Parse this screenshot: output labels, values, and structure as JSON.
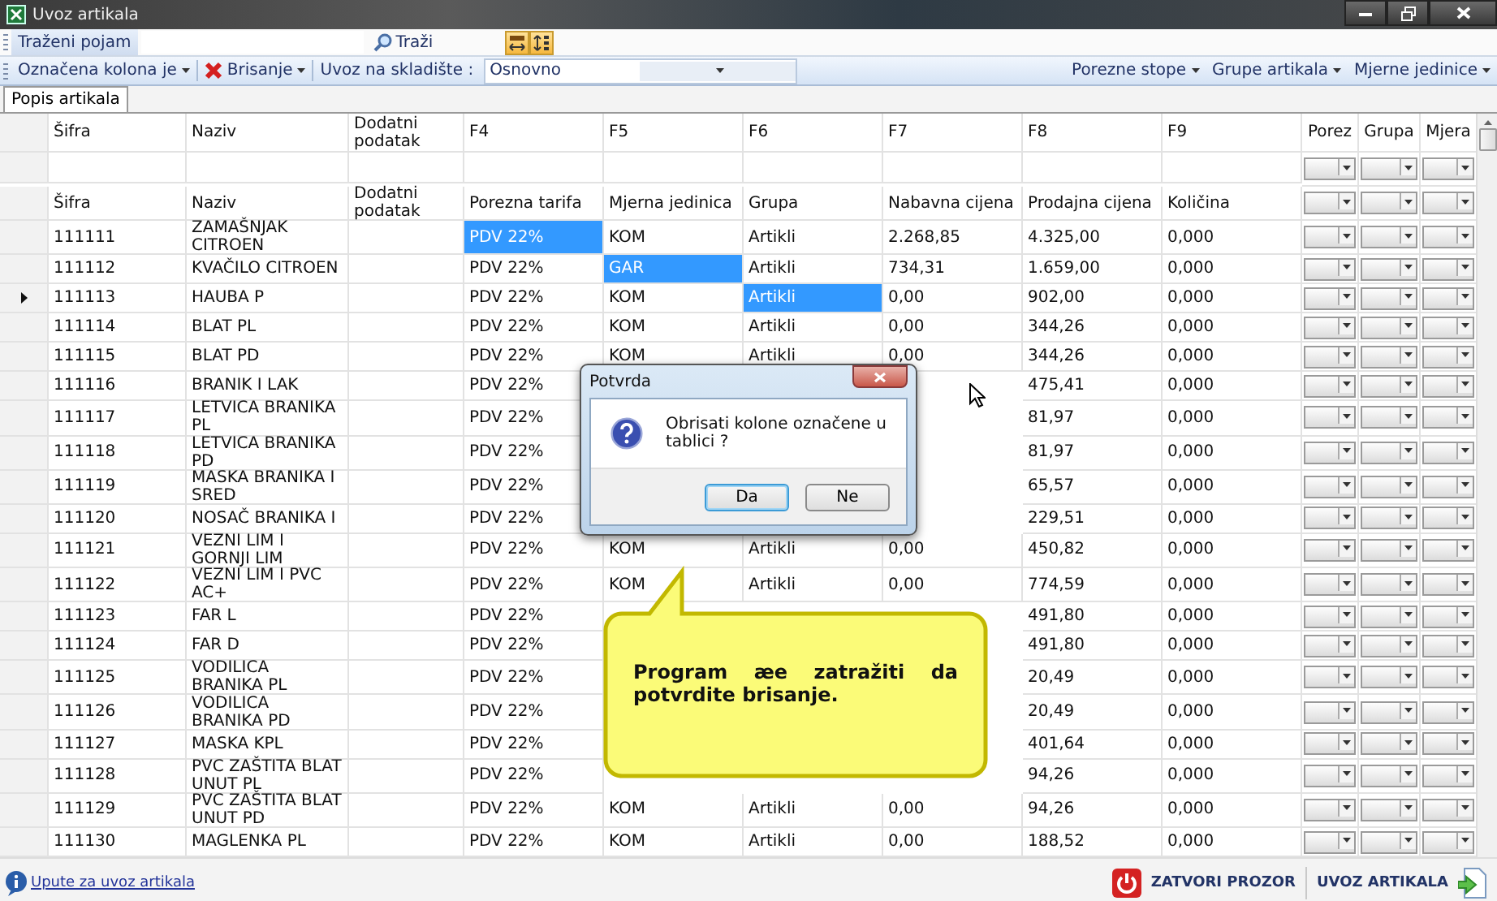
{
  "window": {
    "title": "Uvoz artikala"
  },
  "search_bar": {
    "label": "Traženi pojam",
    "search_button": "Traži"
  },
  "toolbar": {
    "left": [
      {
        "kind": "dropdown",
        "label": "Označena kolona je"
      },
      {
        "kind": "delete",
        "label": "Brisanje"
      }
    ],
    "warehouse_label": "Uvoz na skladište :",
    "warehouse_value": "Osnovno",
    "right": [
      {
        "label": "Porezne stope"
      },
      {
        "label": "Grupe artikala"
      },
      {
        "label": "Mjerne jedinice"
      }
    ]
  },
  "tabs": [
    {
      "label": "Popis artikala",
      "selected": true
    }
  ],
  "table": {
    "columns": [
      "Šifra",
      "Naziv",
      "Dodatni podatak",
      "F4",
      "F5",
      "F6",
      "F7",
      "F8",
      "F9",
      "Porez",
      "Grupa",
      "Mjera"
    ],
    "field_labels": [
      "Šifra",
      "Naziv",
      "Dodatni podatak",
      "Porezna tarifa",
      "Mjerna jedinica",
      "Grupa",
      "Nabavna cijena",
      "Prodajna cijena",
      "Količina"
    ],
    "rows": [
      {
        "current": false,
        "cells": [
          "111111",
          "ZAMAŠNJAK CITROEN",
          null,
          {
            "text": "PDV 22%",
            "selected": true
          },
          "KOM",
          "Artikli",
          "2.268,85",
          "4.325,00",
          "0,000"
        ]
      },
      {
        "current": false,
        "cells": [
          "111112",
          "KVAČILO CITROEN",
          null,
          "PDV 22%",
          {
            "text": "GAR",
            "selected": true
          },
          "Artikli",
          "734,31",
          "1.659,00",
          "0,000"
        ]
      },
      {
        "current": true,
        "cells": [
          "111113",
          "HAUBA P",
          null,
          "PDV 22%",
          "KOM",
          {
            "text": "Artikli",
            "selected": true
          },
          "0,00",
          "902,00",
          "0,000"
        ]
      },
      {
        "current": false,
        "cells": [
          "111114",
          "BLAT PL",
          null,
          "PDV 22%",
          "KOM",
          "Artikli",
          "0,00",
          "344,26",
          "0,000"
        ]
      },
      {
        "current": false,
        "cells": [
          "111115",
          "BLAT PD",
          null,
          "PDV 22%",
          "KOM",
          "Artikli",
          "0,00",
          "344,26",
          "0,000"
        ]
      },
      {
        "current": false,
        "cells": [
          "111116",
          "BRANIK I LAK",
          null,
          "PDV 22%",
          null,
          null,
          null,
          "475,41",
          "0,000"
        ]
      },
      {
        "current": false,
        "cells": [
          "111117",
          "LETVICA BRANIKA PL",
          null,
          "PDV 22%",
          null,
          null,
          null,
          "81,97",
          "0,000"
        ]
      },
      {
        "current": false,
        "cells": [
          "111118",
          "LETVICA BRANIKA PD",
          null,
          "PDV 22%",
          null,
          null,
          null,
          "81,97",
          "0,000"
        ]
      },
      {
        "current": false,
        "cells": [
          "111119",
          "MASKA BRANIKA I SRED",
          null,
          "PDV 22%",
          null,
          null,
          null,
          "65,57",
          "0,000"
        ]
      },
      {
        "current": false,
        "cells": [
          "111120",
          "NOSAČ BRANIKA I",
          null,
          "PDV 22%",
          null,
          null,
          null,
          "229,51",
          "0,000"
        ]
      },
      {
        "current": false,
        "cells": [
          "111121",
          "VEZNI LIM I GORNJI LIM",
          null,
          "PDV 22%",
          "KOM",
          "Artikli",
          "0,00",
          "450,82",
          "0,000"
        ]
      },
      {
        "current": false,
        "cells": [
          "111122",
          "VEZNI LIM I PVC AC+",
          null,
          "PDV 22%",
          "KOM",
          "Artikli",
          "0,00",
          "774,59",
          "0,000"
        ]
      },
      {
        "current": false,
        "cells": [
          "111123",
          "FAR L",
          null,
          "PDV 22%",
          null,
          null,
          null,
          "491,80",
          "0,000"
        ]
      },
      {
        "current": false,
        "cells": [
          "111124",
          "FAR D",
          null,
          "PDV 22%",
          null,
          null,
          null,
          "491,80",
          "0,000"
        ]
      },
      {
        "current": false,
        "cells": [
          "111125",
          "VODILICA BRANIKA PL",
          null,
          "PDV 22%",
          null,
          null,
          null,
          "20,49",
          "0,000"
        ]
      },
      {
        "current": false,
        "cells": [
          "111126",
          "VODILICA BRANIKA PD",
          null,
          "PDV 22%",
          null,
          null,
          null,
          "20,49",
          "0,000"
        ]
      },
      {
        "current": false,
        "cells": [
          "111127",
          "MASKA KPL",
          null,
          "PDV 22%",
          null,
          null,
          null,
          "401,64",
          "0,000"
        ]
      },
      {
        "current": false,
        "cells": [
          "111128",
          "PVC ZAŠTITA BLAT UNUT PL",
          null,
          "PDV 22%",
          null,
          null,
          null,
          "94,26",
          "0,000"
        ]
      },
      {
        "current": false,
        "cells": [
          "111129",
          "PVC ZAŠTITA BLAT UNUT PD",
          null,
          "PDV 22%",
          "KOM",
          "Artikli",
          "0,00",
          "94,26",
          "0,000"
        ]
      },
      {
        "current": false,
        "cells": [
          "111130",
          "MAGLENKA PL",
          null,
          "PDV 22%",
          "KOM",
          "Artikli",
          "0,00",
          "188,52",
          "0,000"
        ]
      }
    ]
  },
  "dialog": {
    "title": "Potvrda",
    "message": "Obrisati kolone označene u tablici ?",
    "buttons": [
      {
        "label": "Da",
        "default": true
      },
      {
        "label": "Ne",
        "default": false
      }
    ]
  },
  "callout": {
    "text": "Program æe zatražiti da potvrdite brisanje."
  },
  "footer": {
    "help_link": "Upute za uvoz artikala",
    "buttons": [
      {
        "kind": "close",
        "label": "ZATVORI PROZOR"
      },
      {
        "kind": "import",
        "label": "UVOZ ARTIKALA"
      }
    ]
  }
}
